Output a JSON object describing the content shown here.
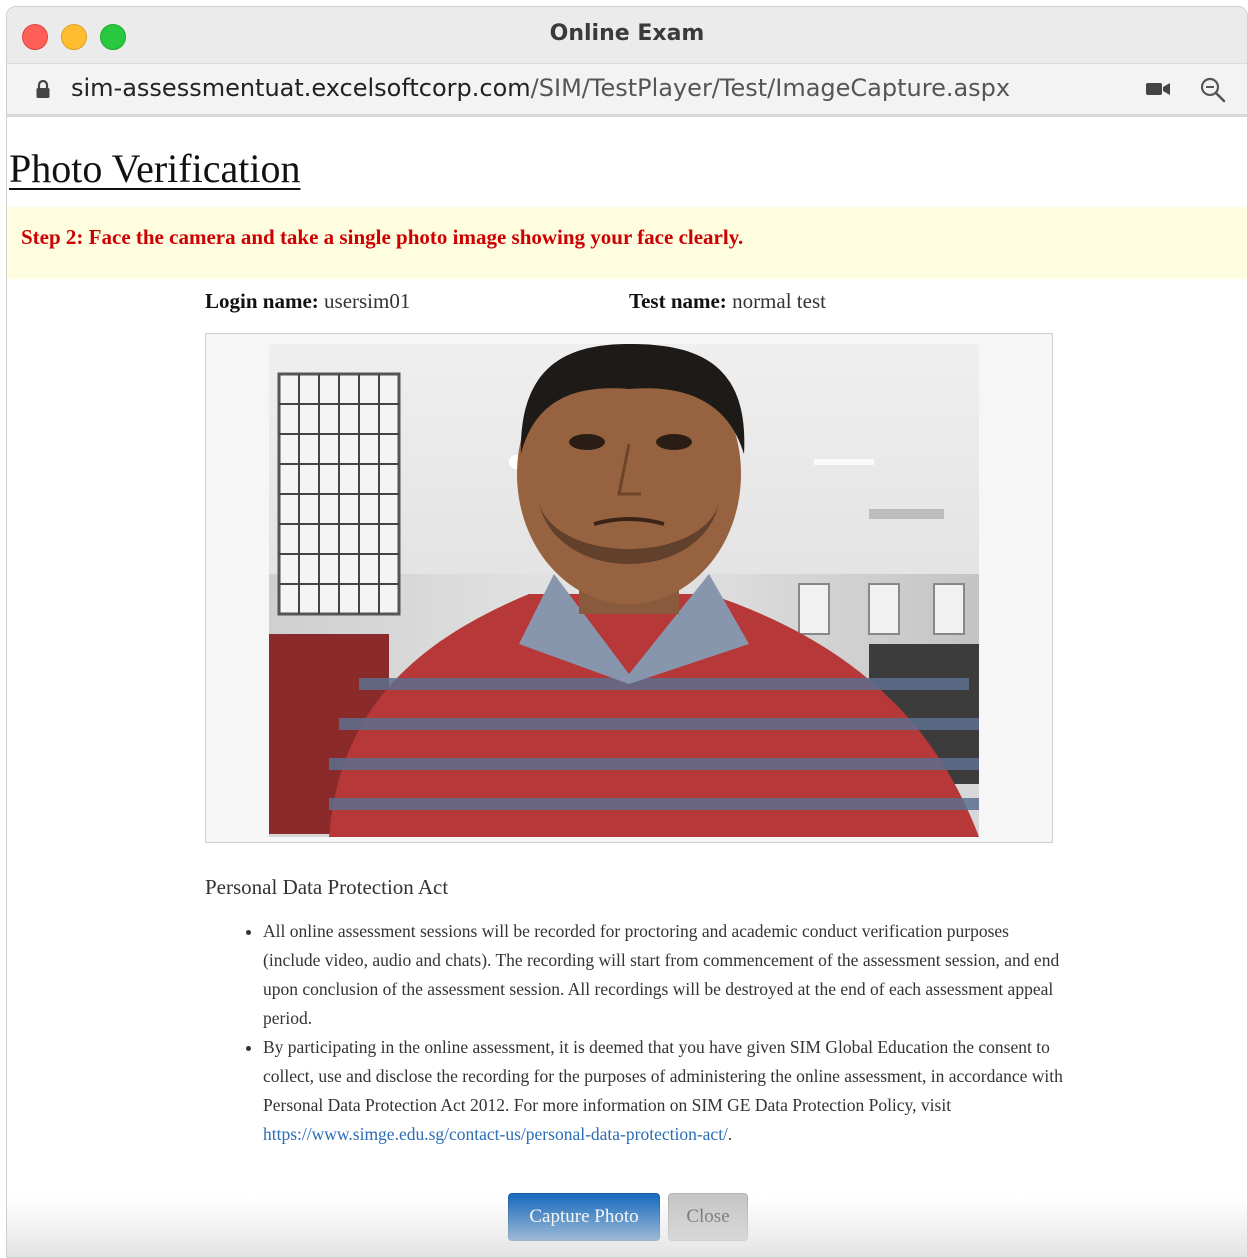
{
  "window": {
    "title": "Online Exam"
  },
  "address_bar": {
    "url_host": "sim-assessmentuat.excelsoftcorp.com",
    "url_path": "/SIM/TestPlayer/Test/ImageCapture.aspx",
    "icons": [
      "lock-icon",
      "video-camera-icon",
      "zoom-icon"
    ]
  },
  "page": {
    "title": "Photo Verification",
    "step_instruction": "Step 2: Face the camera and take a single photo image showing your face clearly.",
    "login_label": "Login name:",
    "login_value": "usersim01",
    "test_label": "Test name:",
    "test_value": "normal test"
  },
  "camera_feed": {
    "content": "webcam-preview"
  },
  "pdpa": {
    "title": "Personal Data Protection Act",
    "bullet_1": "All online assessment sessions will be recorded for proctoring and academic conduct verification purposes (include video, audio and chats). The recording will start from commencement of the assessment session, and end upon conclusion of the assessment session. All recordings will be destroyed at the end of each assessment appeal period.",
    "bullet_2_text": "By participating in the online assessment, it is deemed that you have given SIM Global Education the consent to collect, use and disclose the recording for the purposes of administering the online assessment, in accordance with Personal Data Protection Act 2012. For more information on SIM GE Data Protection Policy, visit",
    "bullet_2_link": "https://www.simge.edu.sg/contact-us/personal-data-protection-act/",
    "bullet_2_end": "."
  },
  "buttons": {
    "capture": "Capture Photo",
    "close": "Close"
  },
  "colors": {
    "step_banner_bg": "#fffde0",
    "step_text": "#cc0000",
    "primary_button": "#1f6fbf",
    "close_button": "#c7c7c7",
    "link": "#2a6db5"
  }
}
